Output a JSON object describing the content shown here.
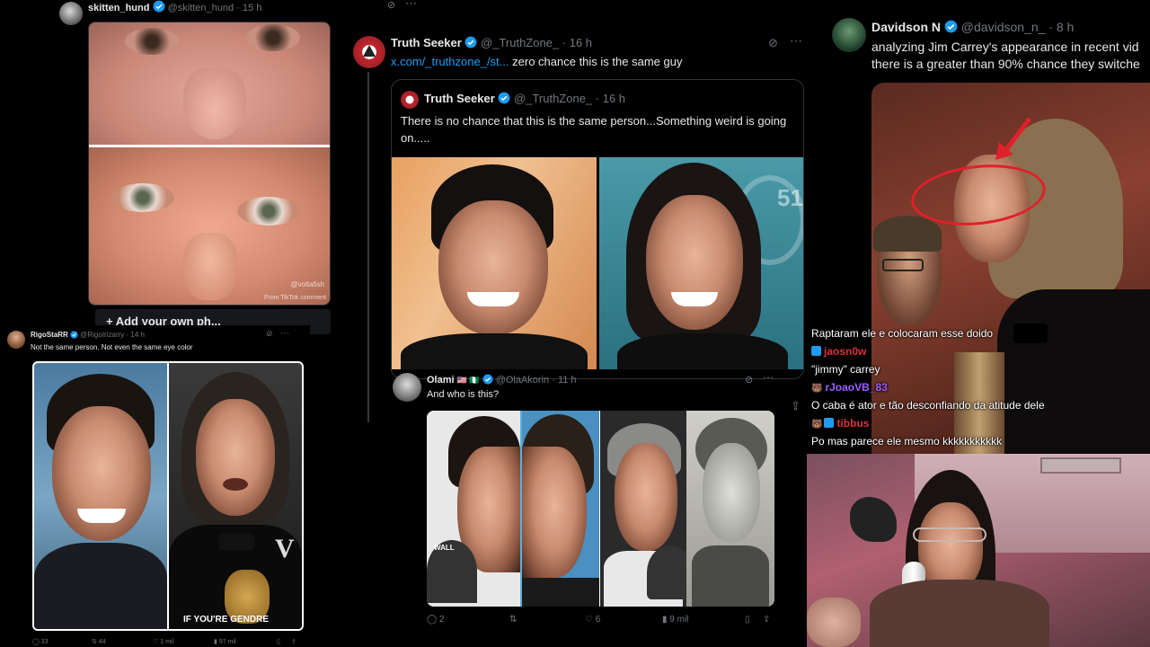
{
  "colors": {
    "accent": "#1d9bf0",
    "bg": "#000000",
    "muted": "#71767b",
    "chat_red": "#e0303a",
    "chat_purple": "#9d5cff"
  },
  "post_skitten": {
    "name": "skitten_hund",
    "handle": "@skitten_hund",
    "time": "· 15 h",
    "watermark": "@voltafish",
    "tiktok": "From TikTok comment",
    "add_photo": "+ Add your own ph..."
  },
  "post_rigo": {
    "name": "RigoStaRR",
    "handle": "@RigoIrizarry",
    "time": "· 14 h",
    "text": "Not the same person. Not even the same eye color",
    "caption": "IF YOU'RE GENDRE",
    "replies": "33",
    "reposts": "44",
    "likes": "1 mil",
    "views": "97 mil"
  },
  "post_truth": {
    "name": "Truth Seeker",
    "handle": "@_TruthZone_",
    "time": "· 16 h",
    "link": "x.com/_truthzone_/st...",
    "text": "zero chance this is the same guy",
    "quote_name": "Truth Seeker",
    "quote_handle": "@_TruthZone_",
    "quote_time": "· 16 h",
    "quote_text": "There is no chance that this is the same person...Something weird is going on.....",
    "bg_number": "51"
  },
  "post_olami": {
    "name": "Olami",
    "flags": "🇺🇸 🇳🇬",
    "handle": "@OlaAkorin",
    "time": "· 11 h",
    "text": "And who is this?",
    "cap_text": "WALL",
    "replies": "2",
    "likes": "6",
    "views": "9 mil"
  },
  "post_davidson": {
    "name": "Davidson N",
    "handle": "@davidson_n_",
    "time": "· 8 h",
    "line1": "analyzing Jim Carrey's appearance in recent vid",
    "line2": "there is a greater than 90% chance they switche"
  },
  "chat": [
    {
      "user": "",
      "message": "Raptaram ele e colocaram esse doido",
      "color": "#ffffff",
      "badges": []
    },
    {
      "user": "jaosn0w",
      "message": "",
      "color": "#e0303a",
      "badges": [
        "sub"
      ]
    },
    {
      "user": "",
      "message": "\"jimmy\" carrey",
      "color": "#ffffff",
      "badges": []
    },
    {
      "user": "rJoaoVB_83",
      "message": "",
      "color": "#9d5cff",
      "badges": [
        "bear"
      ]
    },
    {
      "user": "",
      "message": "O caba é ator e tão desconfiando da atitude dele",
      "color": "#ffffff",
      "badges": []
    },
    {
      "user": "tibbus",
      "message": "",
      "color": "#e0303a",
      "badges": [
        "bear",
        "sub"
      ]
    },
    {
      "user": "",
      "message": "Po mas parece ele mesmo kkkkkkkkkkk",
      "color": "#ffffff",
      "badges": []
    }
  ]
}
